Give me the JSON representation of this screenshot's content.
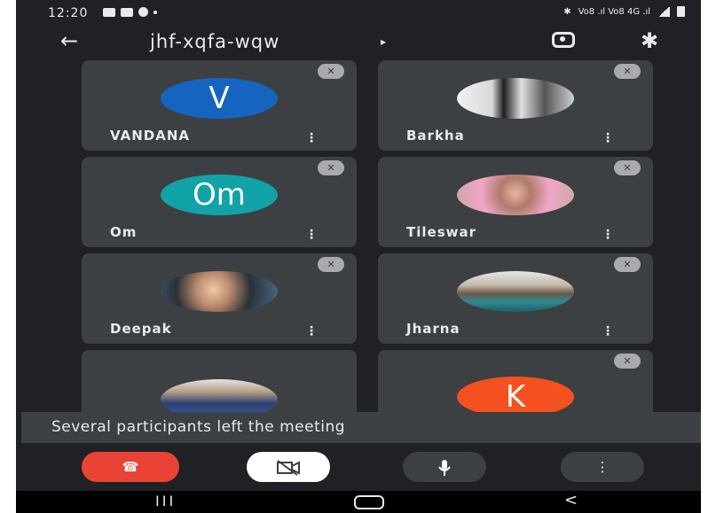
{
  "status": {
    "time": "12:20",
    "right_text": "Vo8 .ıl Vo8 4G .ıl"
  },
  "header": {
    "meeting_code": "jhf-xqfa-wqw",
    "back_icon": "arrow-left-icon",
    "caret": "▸",
    "switch_camera_icon": "switch-camera-icon",
    "bluetooth_icon": "bluetooth-icon"
  },
  "participants": [
    {
      "name": "VANDANA",
      "avatar_text": "V",
      "avatar_color": "#1565c0"
    },
    {
      "name": "Barkha",
      "avatar_text": "",
      "avatar_color": "#d9d9d9"
    },
    {
      "name": "Om",
      "avatar_text": "Om",
      "avatar_color": "#11a3a8"
    },
    {
      "name": "Tileswar",
      "avatar_text": "",
      "avatar_color": "#c9a7a0"
    },
    {
      "name": "Deepak",
      "avatar_text": "",
      "avatar_color": "#4a6a86"
    },
    {
      "name": "Jharna",
      "avatar_text": "",
      "avatar_color": "#4b8b8f"
    },
    {
      "name": "",
      "avatar_text": "",
      "avatar_color": "#3a5fa0"
    },
    {
      "name": "",
      "avatar_text": "K",
      "avatar_color": "#f4511e"
    }
  ],
  "toast": {
    "message": "Several participants left the meeting"
  },
  "controls": {
    "end_call_color": "#ea4335"
  },
  "nav": {
    "recent": "III",
    "back": "<"
  }
}
